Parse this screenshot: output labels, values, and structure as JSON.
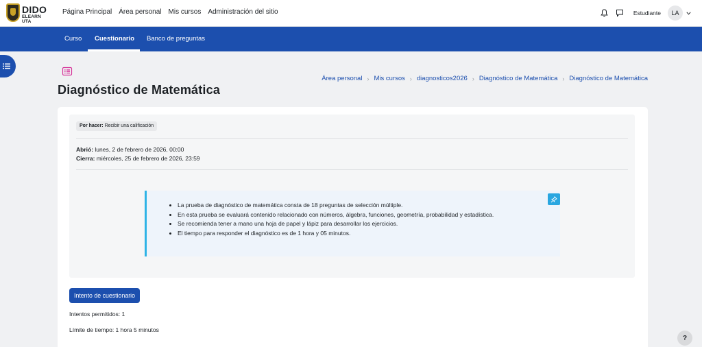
{
  "brand": {
    "name": "DIDO",
    "subtitle": "ELEARN UTA"
  },
  "topnav": {
    "items": [
      "Página Principal",
      "Área personal",
      "Mis cursos",
      "Administración del sitio"
    ]
  },
  "user": {
    "role": "Estudiante",
    "initials": "LA"
  },
  "secondary_nav": {
    "tabs": [
      "Curso",
      "Cuestionario",
      "Banco de preguntas"
    ],
    "active": "Cuestionario"
  },
  "page": {
    "title": "Diagnóstico de Matemática"
  },
  "breadcrumb": [
    "Área personal",
    "Mis cursos",
    "diagnosticos2026",
    "Diagnóstico de Matemática",
    "Diagnóstico de Matemática"
  ],
  "activity": {
    "badge_label": "Por hacer:",
    "badge_value": "Recibir una calificación",
    "opened_label": "Abrió:",
    "opened_value": "lunes, 2 de febrero de 2026, 00:00",
    "closes_label": "Cierra:",
    "closes_value": "miércoles, 25 de febrero de 2026, 23:59"
  },
  "info": {
    "items": [
      "La prueba de diagnóstico de matemática consta de 18 preguntas de selección múltiple.",
      "En esta prueba se evaluará contenido relacionado con números, álgebra, funciones, geometría, probabilidad y estadística.",
      "Se recomienda tener a mano una hoja de papel y lápiz para desarrollar los ejercicios.",
      "El tiempo para responder el diagnóstico es de 1 hora y 05 minutos."
    ]
  },
  "actions": {
    "attempt_button": "Intento de cuestionario"
  },
  "quiz_info": {
    "attempts_allowed": "Intentos permitidos: 1",
    "time_limit": "Límite de tiempo: 1 hora 5 minutos"
  },
  "help": {
    "label": "?"
  },
  "colors": {
    "primary": "#1c4fae",
    "info_accent": "#2db3e6",
    "quiz_icon": "#d6369a"
  }
}
